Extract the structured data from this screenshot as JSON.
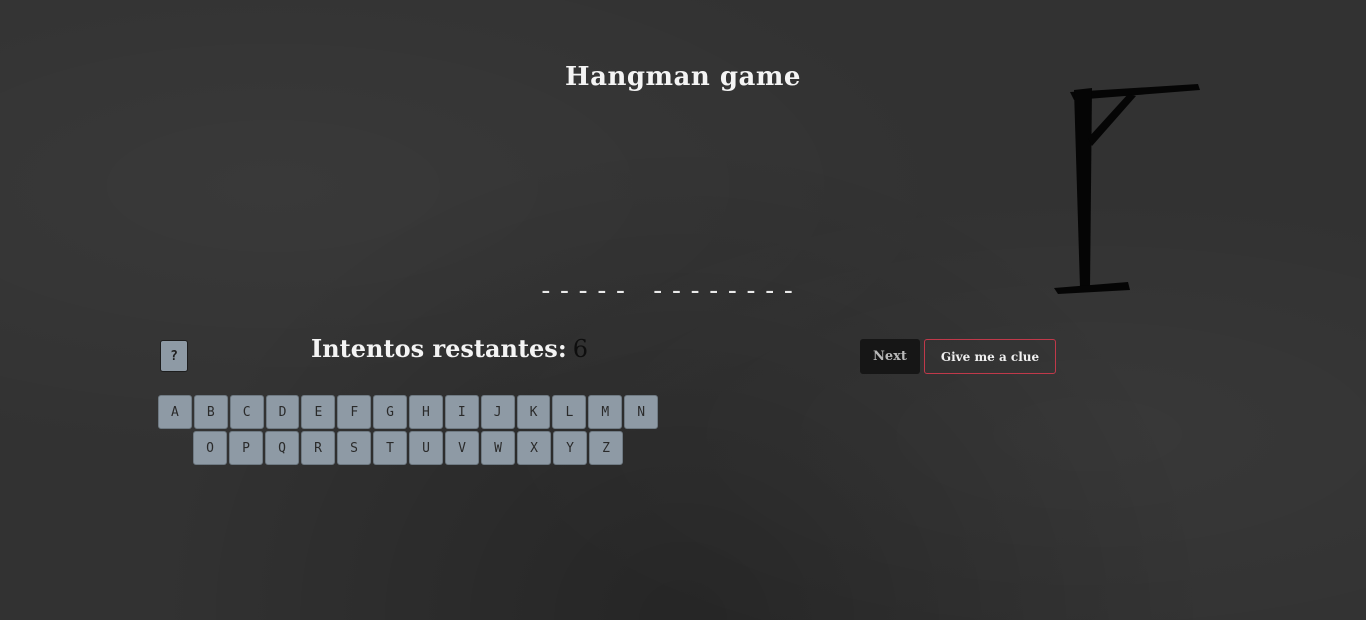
{
  "game": {
    "title": "Hangman game",
    "word_mask": "----- --------",
    "help_label": "?",
    "attempts_label": "Intentos restantes:",
    "attempts_remaining": "6",
    "next_label": "Next",
    "clue_label": "Give me a clue"
  },
  "keyboard": {
    "row1": [
      "A",
      "B",
      "C",
      "D",
      "E",
      "F",
      "G",
      "H",
      "I",
      "J",
      "K",
      "L",
      "M",
      "N"
    ],
    "row2": [
      "O",
      "P",
      "Q",
      "R",
      "S",
      "T",
      "U",
      "V",
      "W",
      "X",
      "Y",
      "Z"
    ]
  },
  "colors": {
    "background": "#323232",
    "key": "#8e9aa5",
    "next_button": "#161616",
    "clue_border": "#c0394a"
  },
  "icons": {
    "gallows": "gallows-icon"
  }
}
